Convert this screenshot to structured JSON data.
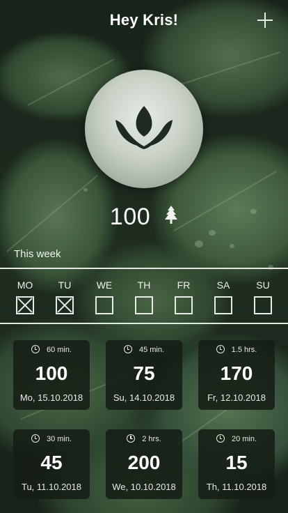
{
  "header": {
    "title": "Hey Kris!"
  },
  "stats": {
    "points": "100"
  },
  "week": {
    "label": "This week",
    "days": [
      {
        "name": "MO",
        "checked": true
      },
      {
        "name": "TU",
        "checked": true
      },
      {
        "name": "WE",
        "checked": false
      },
      {
        "name": "TH",
        "checked": false
      },
      {
        "name": "FR",
        "checked": false
      },
      {
        "name": "SA",
        "checked": false
      },
      {
        "name": "SU",
        "checked": false
      }
    ]
  },
  "sessions": [
    {
      "duration": "60 min.",
      "value": "100",
      "date": "Mo, 15.10.2018"
    },
    {
      "duration": "45 min.",
      "value": "75",
      "date": "Su, 14.10.2018"
    },
    {
      "duration": "1.5 hrs.",
      "value": "170",
      "date": "Fr, 12.10.2018"
    },
    {
      "duration": "30 min.",
      "value": "45",
      "date": "Tu, 11.10.2018"
    },
    {
      "duration": "2 hrs.",
      "value": "200",
      "date": "We, 10.10.2018"
    },
    {
      "duration": "20 min.",
      "value": "15",
      "date": "Th, 11.10.2018"
    }
  ],
  "colors": {
    "accent": "#e8ece6",
    "card_bg": "#161e16",
    "lotus": "#1f2a20"
  },
  "icons": {
    "add": "plus-icon",
    "logo": "lotus-icon",
    "points": "tree-icon",
    "duration": "clock-icon"
  }
}
